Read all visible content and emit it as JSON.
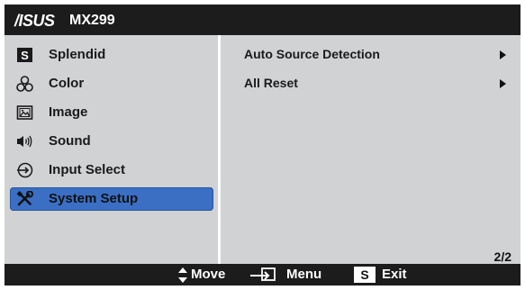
{
  "header": {
    "brand": "/ISUS",
    "model": "MX299"
  },
  "left_menu": [
    {
      "label": "Splendid",
      "icon": "splendid-s-icon",
      "selected": false
    },
    {
      "label": "Color",
      "icon": "color-circles-icon",
      "selected": false
    },
    {
      "label": "Image",
      "icon": "image-icon",
      "selected": false
    },
    {
      "label": "Sound",
      "icon": "speaker-icon",
      "selected": false
    },
    {
      "label": "Input Select",
      "icon": "input-arrow-icon",
      "selected": false
    },
    {
      "label": "System Setup",
      "icon": "tools-icon",
      "selected": true
    }
  ],
  "right_menu": [
    {
      "label": "Auto Source Detection"
    },
    {
      "label": "All Reset"
    }
  ],
  "page_indicator": "2/2",
  "footer": {
    "move": "Move",
    "menu": "Menu",
    "exit": "Exit",
    "exit_key": "S"
  },
  "colors": {
    "selected": "#3a6fc4",
    "bar": "#1c1c1c",
    "panel": "#d1d2d4"
  }
}
